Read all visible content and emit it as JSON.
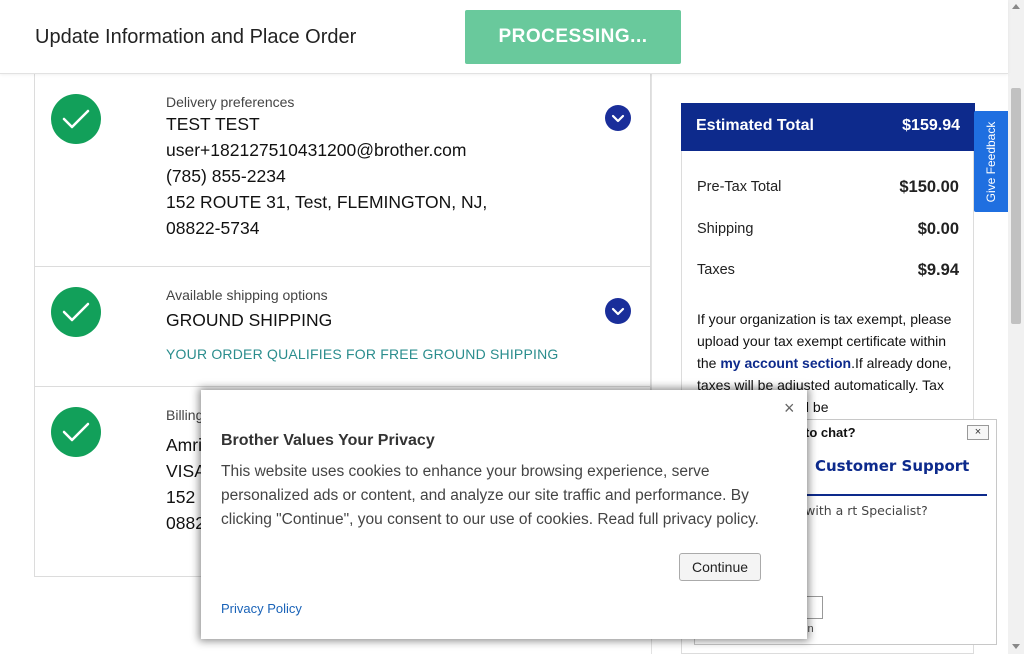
{
  "header": {
    "title": "Update Information and Place Order",
    "processing_label": "PROCESSING..."
  },
  "delivery": {
    "label": "Delivery preferences",
    "lines": [
      "TEST TEST",
      "user+182127510431200@brother.com",
      "(785) 855-2234",
      "152 ROUTE 31, Test, FLEMINGTON, NJ,",
      "08822-5734"
    ]
  },
  "shipping": {
    "label": "Available shipping options",
    "method": "GROUND SHIPPING",
    "free_note": "YOUR ORDER QUALIFIES FOR FREE GROUND SHIPPING"
  },
  "billing": {
    "label": "Billing",
    "lines": [
      "Amri",
      "VISA",
      "152",
      "0882"
    ]
  },
  "summary": {
    "title": "Estimated Total",
    "total": "$159.94",
    "rows": [
      {
        "label": "Pre-Tax Total",
        "value": "$150.00"
      },
      {
        "label": "Shipping",
        "value": "$0.00"
      },
      {
        "label": "Taxes",
        "value": "$9.94"
      }
    ],
    "tax_note_pre": "If your organization is tax exempt, please upload your tax exempt certificate within the ",
    "tax_note_link": "my account section",
    "tax_note_post": ".If already done, taxes will be adjusted automatically. Tax Exempt status will be"
  },
  "feedback": {
    "label": "Give Feedback"
  },
  "chat": {
    "title": "to chat?",
    "close": "×",
    "support_title": "Customer Support",
    "question": "o chat with a rt Specialist?",
    "login_text": "in"
  },
  "privacy_modal": {
    "close": "×",
    "title": "Brother Values Your Privacy",
    "body": "This website uses cookies to enhance your browsing experience, serve personalized ads or content, and analyze our site traffic and performance. By clicking \"Continue\", you consent to our use of cookies. Read full privacy policy.",
    "continue_label": "Continue",
    "privacy_link": "Privacy Policy"
  },
  "colors": {
    "accent_navy": "#0d2a8c",
    "check_green": "#12a05a",
    "processing_green": "#69c99c",
    "feedback_blue": "#1f6fe0"
  },
  "icons": [
    "check-icon",
    "chevron-down-icon",
    "close-icon"
  ]
}
